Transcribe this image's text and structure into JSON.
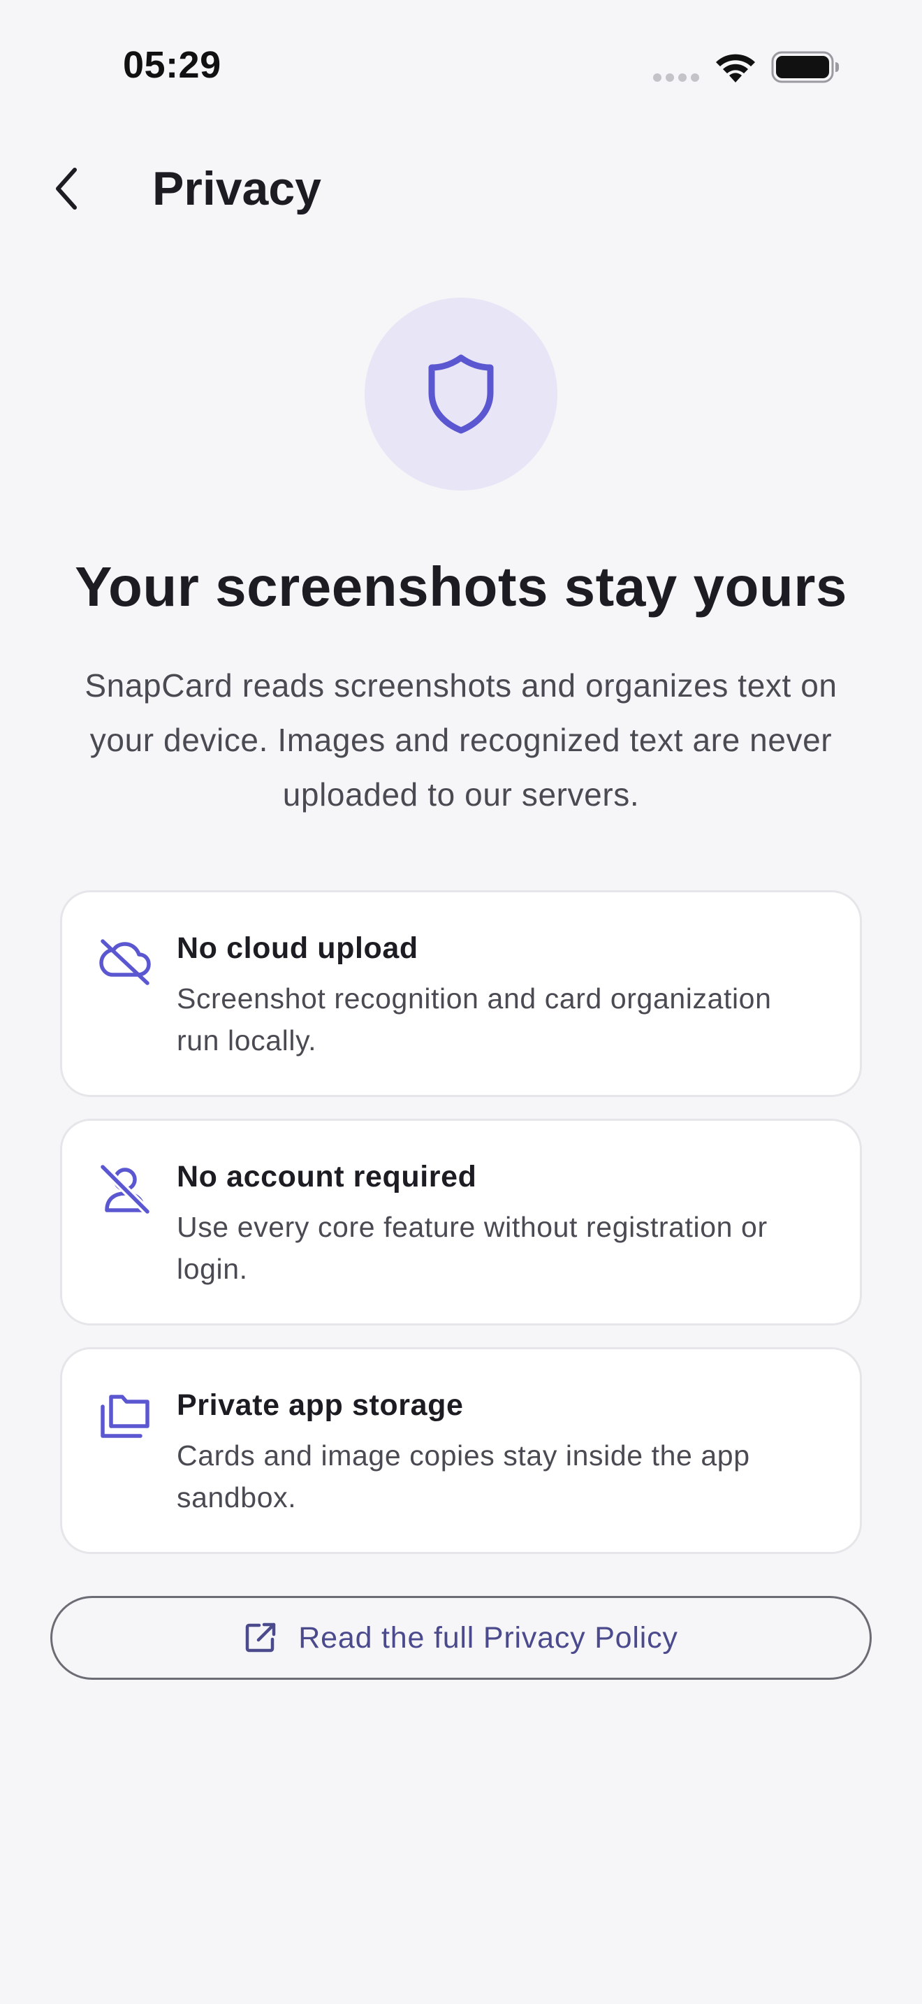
{
  "status_bar": {
    "time": "05:29"
  },
  "header": {
    "title": "Privacy"
  },
  "hero": {
    "icon": "shield-icon",
    "title": "Your screenshots stay yours",
    "description": "SnapCard reads screenshots and organizes text on your device. Images and recognized text are never uploaded to our servers."
  },
  "features": [
    {
      "icon": "cloud-off-icon",
      "title": "No cloud upload",
      "description": "Screenshot recognition and card organization run locally."
    },
    {
      "icon": "user-off-icon",
      "title": "No account required",
      "description": "Use every core feature without registration or login."
    },
    {
      "icon": "folders-icon",
      "title": "Private app storage",
      "description": "Cards and image copies stay inside the app sandbox."
    }
  ],
  "policy_button": {
    "icon": "external-link-icon",
    "label": "Read the full Privacy Policy"
  },
  "colors": {
    "accent": "#5b57d1",
    "background": "#f6f6f9",
    "hero_circle": "#e8e6f6"
  }
}
